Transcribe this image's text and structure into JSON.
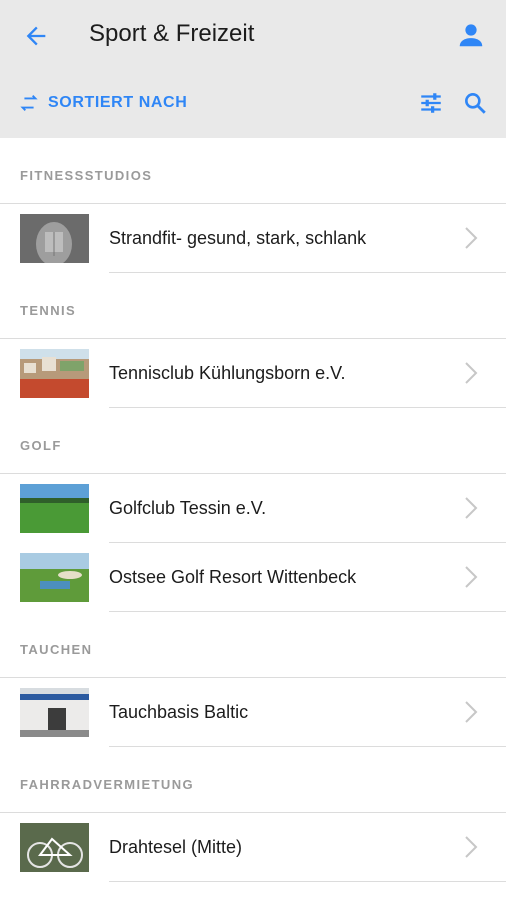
{
  "header": {
    "title": "Sport & Freizeit",
    "sort_label": "SORTIERT NACH",
    "accent": "#2f86f6",
    "icons": [
      "arrow-left-icon",
      "user-icon",
      "swap-icon",
      "filter-sliders-icon",
      "search-icon"
    ]
  },
  "sections": [
    {
      "title": "FITNESSSTUDIOS",
      "items": [
        {
          "label": "Strandfit- gesund, stark, schlank",
          "thumb": "fitness"
        }
      ]
    },
    {
      "title": "TENNIS",
      "items": [
        {
          "label": "Tennisclub Kühlungsborn e.V.",
          "thumb": "tennis"
        }
      ]
    },
    {
      "title": "GOLF",
      "items": [
        {
          "label": "Golfclub Tessin e.V.",
          "thumb": "golf1"
        },
        {
          "label": "Ostsee Golf Resort Wittenbeck",
          "thumb": "golf2"
        }
      ]
    },
    {
      "title": "TAUCHEN",
      "items": [
        {
          "label": "Tauchbasis Baltic",
          "thumb": "diving"
        }
      ]
    },
    {
      "title": "FAHRRADVERMIETUNG",
      "items": [
        {
          "label": "Drahtesel (Mitte)",
          "thumb": "bike"
        }
      ]
    }
  ]
}
